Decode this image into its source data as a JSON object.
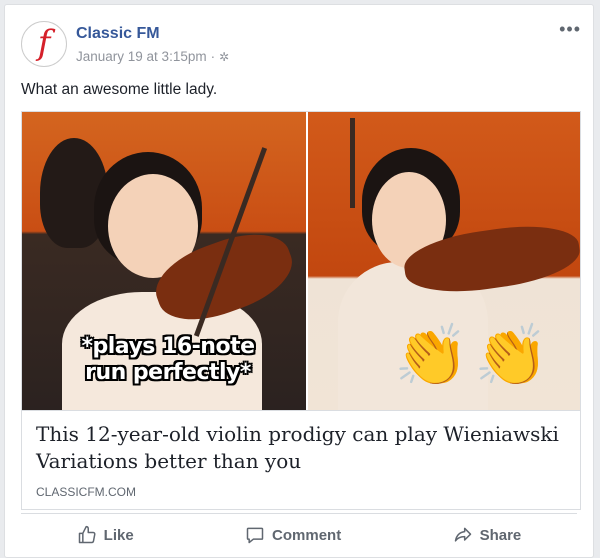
{
  "post": {
    "page_name": "Classic FM",
    "avatar_letter": "f",
    "timestamp": "January 19 at 3:15pm",
    "separator": "·",
    "privacy_icon": "globe-icon",
    "more_label": "•••",
    "message": "What an awesome little lady."
  },
  "link_preview": {
    "image_caption": "*plays 16-note run perfectly*",
    "clap_emoji": "👏",
    "headline": "This 12-year-old violin prodigy can play Wieniawski Variations better than you",
    "domain": "CLASSICFM.COM"
  },
  "actions": {
    "like_label": "Like",
    "comment_label": "Comment",
    "share_label": "Share"
  },
  "colors": {
    "brand_link": "#365899",
    "logo_red": "#d5202a",
    "muted": "#606770"
  }
}
